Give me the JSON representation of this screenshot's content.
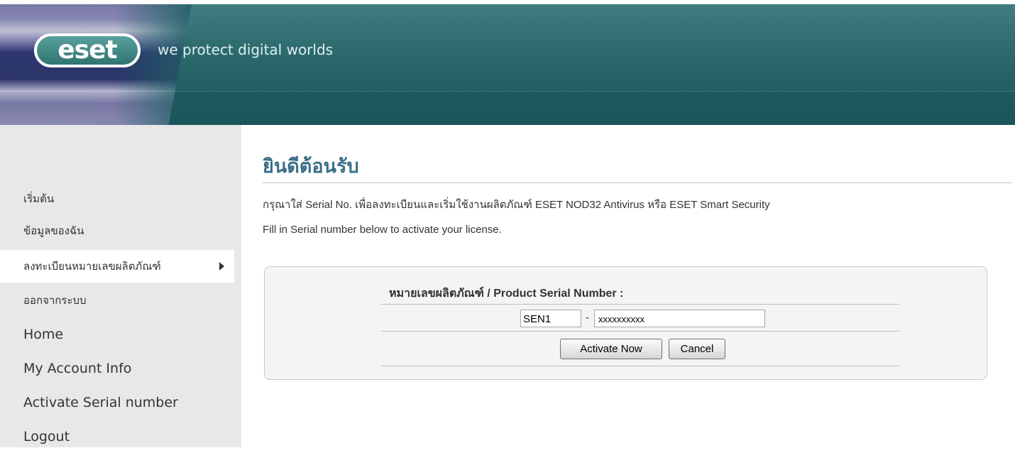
{
  "header": {
    "logo_text": "eset",
    "tagline": "we protect digital worlds",
    "colors": {
      "header_bg": "#1f6064",
      "logo_bg": "#2f7471"
    }
  },
  "sidebar": {
    "items": [
      {
        "label": "เริ่มต้น",
        "active": false
      },
      {
        "label": "ข้อมูลของฉัน",
        "active": false
      },
      {
        "label": "ลงทะเบียนหมายเลขผลิตภัณฑ์",
        "active": true,
        "icon": "caret-right-icon"
      },
      {
        "label": "ออกจากระบบ",
        "active": false
      },
      {
        "label": "Home",
        "active": false
      },
      {
        "label": "My Account Info",
        "active": false
      },
      {
        "label": "Activate Serial number",
        "active": false
      },
      {
        "label": "Logout",
        "active": false
      }
    ]
  },
  "main": {
    "title": "ยินดีต้อนรับ",
    "intro_th": "กรุณาใส่ Serial No. เพื่อลงทะเบียนและเริ่มใช้งานผลิตภัณฑ์ ESET NOD32 Antivirus หรือ ESET Smart Security",
    "intro_en": "Fill in Serial number below to activate your license.",
    "title_color": "#3a6f86"
  },
  "form": {
    "label": "หมายเลขผลิตภัณฑ์ / Product Serial Number :",
    "prefix_value": "SEN1",
    "separator": "-",
    "serial_value": "xxxxxxxxxx",
    "activate_label": "Activate Now",
    "cancel_label": "Cancel"
  }
}
